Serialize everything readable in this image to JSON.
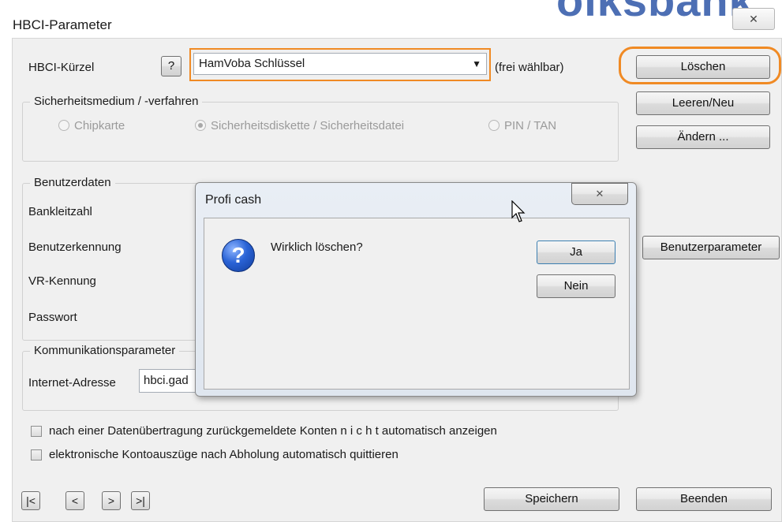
{
  "window": {
    "title": "HBCI-Parameter",
    "banner_text": "olksbank",
    "close_glyph": "✕"
  },
  "form": {
    "hbci_kuerzel_label": "HBCI-Kürzel",
    "help_button": "?",
    "hbci_kuerzel_value": "HamVoba Schlüssel",
    "dropdown_arrow": "▼",
    "frei_label": "(frei wählbar)",
    "sicherheit_title": "Sicherheitsmedium / -verfahren",
    "radio_chipkarte": "Chipkarte",
    "radio_diskette": "Sicherheitsdiskette / Sicherheitsdatei",
    "radio_pin": "PIN / TAN",
    "benutzerdaten_title": "Benutzerdaten",
    "bankleitzahl_label": "Bankleitzahl",
    "benutzerkennung_label": "Benutzerkennung",
    "vr_kennung_label": "VR-Kennung",
    "passwort_label": "Passwort",
    "kommunikation_title": "Kommunikationsparameter",
    "internet_label": "Internet-Adresse",
    "internet_value": "hbci.gad"
  },
  "buttons": {
    "loeschen": "Löschen",
    "leeren_neu": "Leeren/Neu",
    "aendern": "Ändern ...",
    "benutzerparameter": "Benutzerparameter",
    "speichern": "Speichern",
    "beenden": "Beenden"
  },
  "checkboxes": {
    "konten": "nach einer Datenübertragung zurückgemeldete Konten  n i c h t  automatisch anzeigen",
    "kontoauszuege": "elektronische Kontoauszüge nach Abholung automatisch quittieren"
  },
  "nav": {
    "first": "|<",
    "prev": "<",
    "next": ">",
    "last": ">|"
  },
  "dialog": {
    "title": "Profi cash",
    "close_glyph": "✕",
    "icon_glyph": "?",
    "message": "Wirklich löschen?",
    "yes": "Ja",
    "no": "Nein"
  },
  "colors": {
    "highlight": "#f08a24",
    "panel": "#f0f0f0"
  }
}
